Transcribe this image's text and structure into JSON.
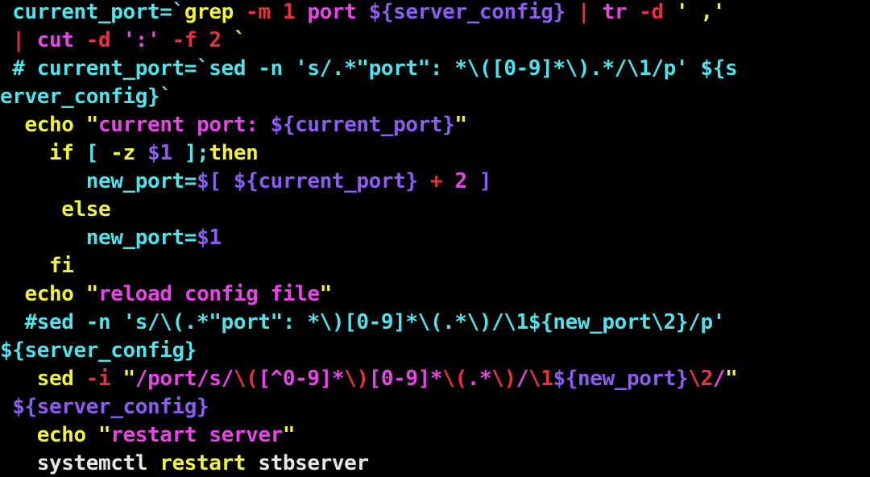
{
  "colors": {
    "background": "#000000",
    "cyan": "#4FE3EB",
    "yellow": "#F2F23A",
    "magenta": "#E844E8",
    "red": "#E8313C",
    "purple": "#8E5CF2",
    "white": "#E6E6E6"
  },
  "lines": [
    {
      "tokens": [
        {
          "t": " current_port=`",
          "c": "cyan"
        },
        {
          "t": "grep ",
          "c": "yellow"
        },
        {
          "t": "-m 1 ",
          "c": "red"
        },
        {
          "t": "port ",
          "c": "magenta"
        },
        {
          "t": "${server_config}",
          "c": "purple"
        },
        {
          "t": " | ",
          "c": "red"
        },
        {
          "t": "tr ",
          "c": "magenta"
        },
        {
          "t": "-d ",
          "c": "red"
        },
        {
          "t": "' ,'",
          "c": "yellow"
        }
      ]
    },
    {
      "tokens": [
        {
          "t": " | ",
          "c": "red"
        },
        {
          "t": "cut ",
          "c": "magenta"
        },
        {
          "t": "-d ",
          "c": "red"
        },
        {
          "t": "':' ",
          "c": "magenta"
        },
        {
          "t": "-f 2 ",
          "c": "red"
        },
        {
          "t": "`",
          "c": "yellow"
        }
      ]
    },
    {
      "tokens": [
        {
          "t": " # current_port=`sed -n 's/.*\"port\": *\\([0-9]*\\).*/\\1/p' ${s",
          "c": "cyan"
        }
      ]
    },
    {
      "tokens": [
        {
          "t": "erver_config}`",
          "c": "cyan"
        }
      ]
    },
    {
      "tokens": [
        {
          "t": "  echo ",
          "c": "yellow"
        },
        {
          "t": "\"",
          "c": "yellow"
        },
        {
          "t": "current port: ",
          "c": "magenta"
        },
        {
          "t": "${current_port}",
          "c": "purple"
        },
        {
          "t": "\"",
          "c": "yellow"
        }
      ]
    },
    {
      "tokens": [
        {
          "t": "    if ",
          "c": "yellow"
        },
        {
          "t": "[ ",
          "c": "cyan"
        },
        {
          "t": "-z ",
          "c": "yellow"
        },
        {
          "t": "$1",
          "c": "purple"
        },
        {
          "t": " ];",
          "c": "cyan"
        },
        {
          "t": "then",
          "c": "yellow"
        }
      ]
    },
    {
      "tokens": [
        {
          "t": "       new_port=",
          "c": "cyan"
        },
        {
          "t": "$[ ",
          "c": "purple"
        },
        {
          "t": "${current_port}",
          "c": "purple"
        },
        {
          "t": " + ",
          "c": "red"
        },
        {
          "t": "2",
          "c": "magenta"
        },
        {
          "t": " ]",
          "c": "purple"
        }
      ]
    },
    {
      "tokens": [
        {
          "t": "     else",
          "c": "yellow"
        }
      ]
    },
    {
      "tokens": [
        {
          "t": "       new_port=",
          "c": "cyan"
        },
        {
          "t": "$1",
          "c": "purple"
        }
      ]
    },
    {
      "tokens": [
        {
          "t": "    fi",
          "c": "yellow"
        }
      ]
    },
    {
      "tokens": [
        {
          "t": "  echo ",
          "c": "yellow"
        },
        {
          "t": "\"",
          "c": "yellow"
        },
        {
          "t": "reload config file",
          "c": "magenta"
        },
        {
          "t": "\"",
          "c": "yellow"
        }
      ]
    },
    {
      "tokens": [
        {
          "t": "  #sed -n 's/\\(.*\"port\": *\\)[0-9]*\\(.*\\)/\\1${new_port\\2}/p'",
          "c": "cyan"
        }
      ]
    },
    {
      "tokens": [
        {
          "t": "${server_config}",
          "c": "cyan"
        }
      ]
    },
    {
      "tokens": [
        {
          "t": "   sed ",
          "c": "yellow"
        },
        {
          "t": "-i ",
          "c": "red"
        },
        {
          "t": "\"",
          "c": "yellow"
        },
        {
          "t": "/port/s/",
          "c": "magenta"
        },
        {
          "t": "\\(",
          "c": "red"
        },
        {
          "t": "[^0-9]*",
          "c": "magenta"
        },
        {
          "t": "\\)",
          "c": "red"
        },
        {
          "t": "[0-9]*",
          "c": "magenta"
        },
        {
          "t": "\\(",
          "c": "red"
        },
        {
          "t": ".*",
          "c": "magenta"
        },
        {
          "t": "\\)",
          "c": "red"
        },
        {
          "t": "/",
          "c": "magenta"
        },
        {
          "t": "\\1",
          "c": "red"
        },
        {
          "t": "${new_port}",
          "c": "purple"
        },
        {
          "t": "\\2",
          "c": "red"
        },
        {
          "t": "/",
          "c": "magenta"
        },
        {
          "t": "\"",
          "c": "yellow"
        }
      ]
    },
    {
      "tokens": [
        {
          "t": " ${server_config}",
          "c": "purple"
        }
      ]
    },
    {
      "tokens": [
        {
          "t": "   echo ",
          "c": "yellow"
        },
        {
          "t": "\"",
          "c": "yellow"
        },
        {
          "t": "restart server",
          "c": "magenta"
        },
        {
          "t": "\"",
          "c": "yellow"
        }
      ]
    },
    {
      "tokens": [
        {
          "t": "   systemctl ",
          "c": "white"
        },
        {
          "t": "restart ",
          "c": "yellow"
        },
        {
          "t": "stbserver",
          "c": "white"
        }
      ]
    }
  ]
}
